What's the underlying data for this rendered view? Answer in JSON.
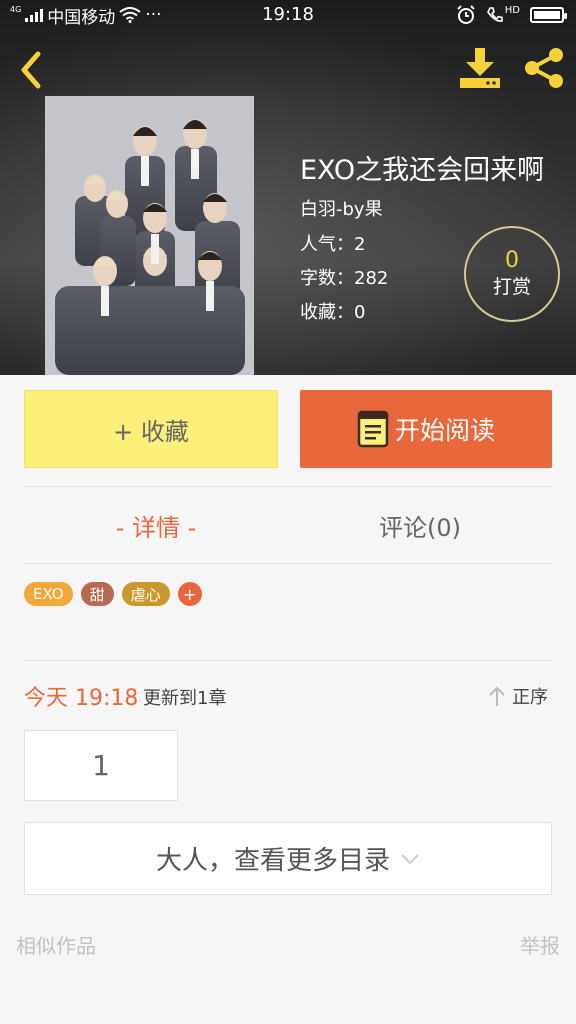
{
  "status_bar": {
    "network_small": "4G",
    "carrier": "中国移动",
    "more": "···",
    "time": "19:18",
    "hd": "HD"
  },
  "icons": {
    "back": "chevron-left-icon",
    "download": "download-icon",
    "share": "share-icon",
    "read": "book-icon",
    "sort": "arrow-up-icon",
    "more": "chevron-down-icon"
  },
  "book": {
    "title": "EXO之我还会回来啊",
    "author": "白羽-by果",
    "popularity": "人气：2",
    "word_count": "字数：282",
    "favorites": "收藏：0"
  },
  "tip": {
    "count": "0",
    "label": "打赏"
  },
  "actions": {
    "collect": "+ 收藏",
    "read": "开始阅读"
  },
  "tabs": {
    "details": "- 详情 -",
    "comments": "评论(0)"
  },
  "tags": [
    {
      "label": "EXO",
      "color": "#f3a73a"
    },
    {
      "label": "甜",
      "color": "#b8694e"
    },
    {
      "label": "虐心",
      "color": "#c9982f"
    },
    {
      "label": "+",
      "color": "#e8683c"
    }
  ],
  "update": {
    "today": "今天 19:18",
    "text": "更新到1章",
    "sort": "正序"
  },
  "chapters": [
    "1"
  ],
  "more_toc": "大人，查看更多目录",
  "footer": {
    "similar": "相似作品",
    "report": "举报"
  },
  "colors": {
    "accent": "#e8683c",
    "collect_bg": "#fdf07a",
    "icon_yellow": "#f5d23a"
  }
}
